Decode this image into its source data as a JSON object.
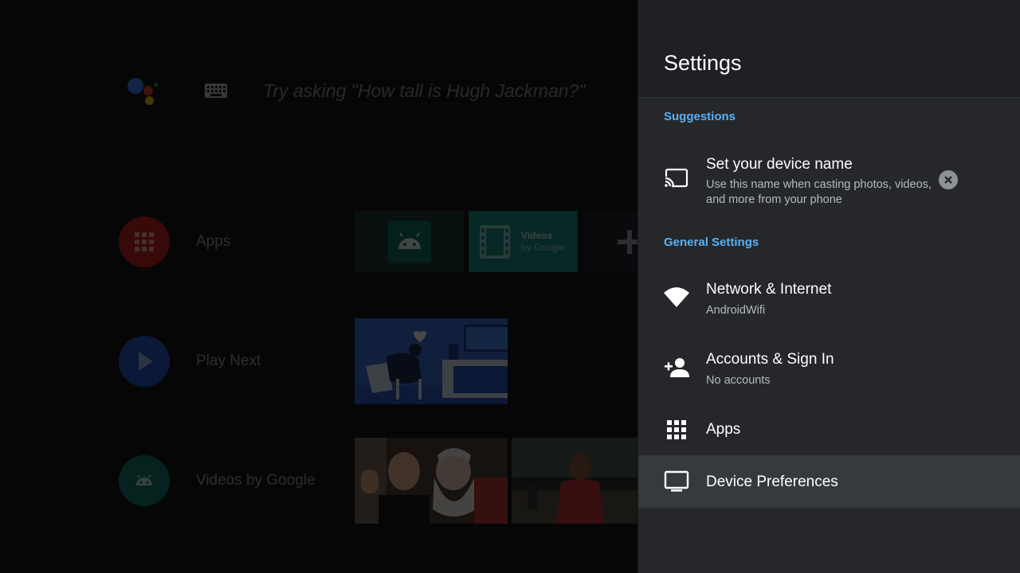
{
  "home": {
    "search_hint": "Try asking \"How tall is Hugh Jackman?\"",
    "assistant_icon": "google-assistant-icon",
    "keyboard_icon": "keyboard-icon",
    "rows": [
      {
        "label": "Apps",
        "icon": "apps-grid-icon",
        "color": "#c5221f"
      },
      {
        "label": "Play Next",
        "icon": "play-icon",
        "color": "#2a56c6"
      },
      {
        "label": "Videos by Google",
        "icon": "android-icon",
        "color": "#137a6d"
      }
    ],
    "app_tiles": [
      {
        "name": "android-app-tile"
      },
      {
        "name": "videos-by-google-tile",
        "line1": "Videos",
        "line2": "by Google"
      },
      {
        "name": "add-app-tile"
      }
    ]
  },
  "settings": {
    "title": "Settings",
    "suggestions_label": "Suggestions",
    "suggestion": {
      "title": "Set your device name",
      "subtitle_line1": "Use this name when casting photos, videos,",
      "subtitle_line2": "and more from your phone",
      "icon": "cast-icon",
      "dismiss_icon": "close-circle-icon"
    },
    "general_label": "General Settings",
    "items": [
      {
        "title": "Network & Internet",
        "subtitle": "AndroidWifi",
        "icon": "wifi-icon"
      },
      {
        "title": "Accounts & Sign In",
        "subtitle": "No accounts",
        "icon": "add-person-icon"
      },
      {
        "title": "Apps",
        "subtitle": "",
        "icon": "apps-grid-icon"
      },
      {
        "title": "Device Preferences",
        "subtitle": "",
        "icon": "tv-icon",
        "focused": true
      }
    ]
  },
  "colors": {
    "accent": "#5ab0f5",
    "panel_bg": "#25272b",
    "focused_bg": "#36393d"
  }
}
